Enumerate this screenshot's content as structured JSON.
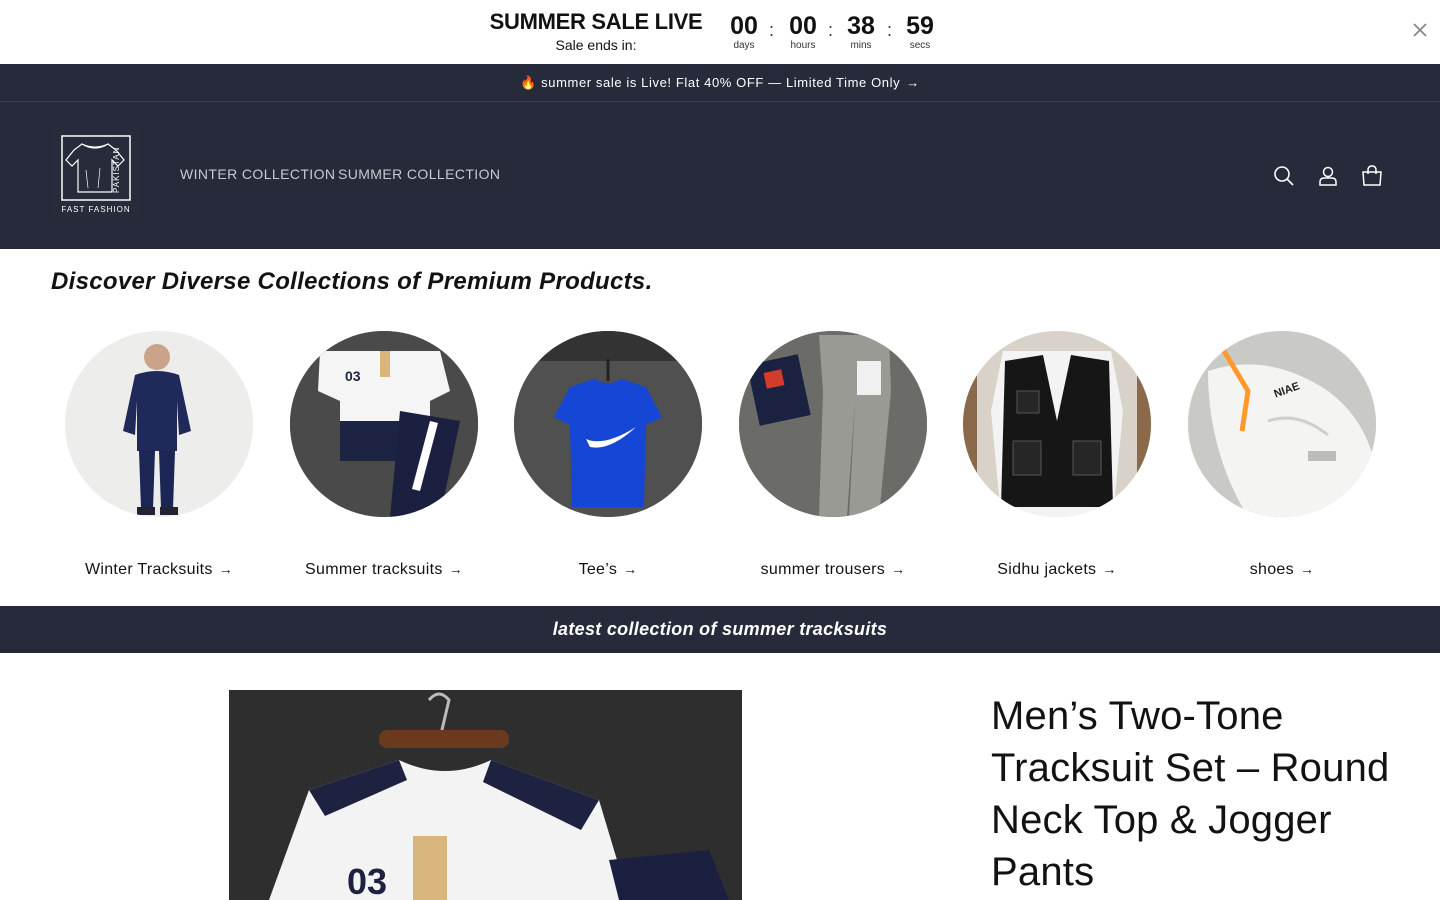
{
  "countdown": {
    "title": "SUMMER SALE LIVE",
    "subtitle": "Sale ends in:",
    "units": [
      {
        "value": "00",
        "label": "days"
      },
      {
        "value": "00",
        "label": "hours"
      },
      {
        "value": "38",
        "label": "mins"
      },
      {
        "value": "59",
        "label": "secs"
      }
    ],
    "separator": ":",
    "close_icon": "close-icon"
  },
  "announcement": {
    "text": "🔥 summer sale is Live! Flat 40% OFF — Limited Time Only",
    "arrow": "→"
  },
  "header": {
    "logo_side_text": "PAKISTAN",
    "logo_bottom_text": "FAST FASHION",
    "nav": [
      {
        "label": "WINTER COLLECTION"
      },
      {
        "label": "SUMMER COLLECTION"
      }
    ],
    "icons": [
      "search-icon",
      "account-icon",
      "cart-icon"
    ]
  },
  "discover": {
    "heading": "Discover Diverse Collections of Premium Products."
  },
  "collections": [
    {
      "label": "Winter Tracksuits",
      "arrow": "→"
    },
    {
      "label": "Summer tracksuits",
      "arrow": "→"
    },
    {
      "label": "Tee’s",
      "arrow": "→"
    },
    {
      "label": "summer trousers",
      "arrow": "→"
    },
    {
      "label": "Sidhu jackets",
      "arrow": "→"
    },
    {
      "label": "shoes",
      "arrow": "→"
    }
  ],
  "banner": {
    "text": "latest collection of summer tracksuits"
  },
  "product": {
    "title": "Men’s Two-Tone Tracksuit Set – Round Neck Top & Jogger Pants"
  },
  "colors": {
    "header_bg": "#262a3a",
    "text": "#121212",
    "white": "#ffffff"
  }
}
